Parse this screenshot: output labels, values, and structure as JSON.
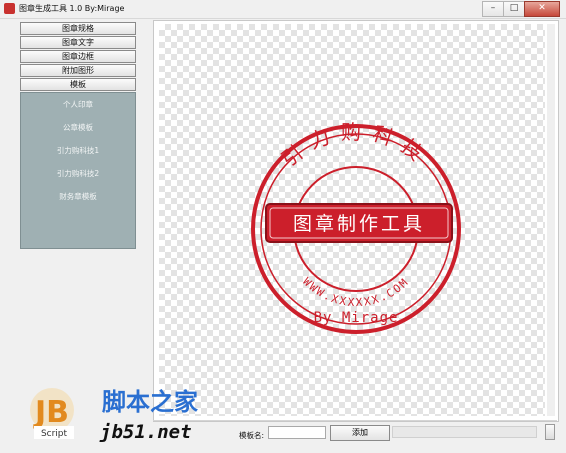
{
  "window": {
    "title": "图章生成工具 1.0   By:Mirage",
    "minimize": "–",
    "maximize": "□",
    "close": "✕"
  },
  "sidebar": {
    "buttons": [
      "图章规格",
      "图章文字",
      "图章边框",
      "附加图形",
      "模板"
    ],
    "templates": [
      "个人印章",
      "公章模板",
      "引力购科技1",
      "引力购科技2",
      "财务章模板"
    ]
  },
  "stamp": {
    "arc_text": "引力购科技",
    "banner_text": "图章制作工具",
    "bottom_arc_text": "WWW.XXXXXX.COM",
    "signature": "By Mirage",
    "color": "#cc1f2b"
  },
  "bottom": {
    "template_name_label": "模板名:",
    "template_name_value": "",
    "add_button": "添加"
  },
  "watermark": {
    "jb_script": "Script",
    "cn_text": "脚本之家",
    "url": "jb51.net"
  },
  "colors": {
    "panel": "#9fb0b3",
    "stamp_red": "#cc1f2b",
    "logo_blue": "#2a6fd1",
    "logo_orange": "#e28a1e"
  }
}
